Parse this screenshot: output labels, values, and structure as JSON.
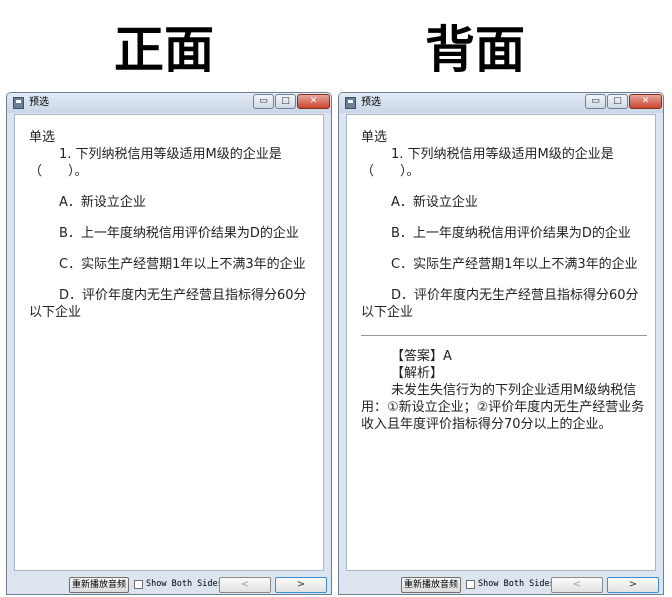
{
  "headings": {
    "front": "正面",
    "back": "背面"
  },
  "window": {
    "title": "预选",
    "minimize_glyph": "▭",
    "maximize_glyph": "□",
    "close_glyph": "✕"
  },
  "question": {
    "type": "单选",
    "stem": "1. 下列纳税信用等级适用M级的企业是（　　）。",
    "options": [
      "A．新设立企业",
      "B．上一年度纳税信用评价结果为D的企业",
      "C．实际生产经营期1年以上不满3年的企业",
      "D．评价年度内无生产经营且指标得分60分以下企业"
    ]
  },
  "answer": {
    "answer_label": "【答案】A",
    "explanation_label": "【解析】",
    "explanation": "未发生失信行为的下列企业适用M级纳税信用：①新设立企业；②评价年度内无生产经营业务收入且年度评价指标得分70分以上的企业。"
  },
  "bottom_bar": {
    "replay_label": "重新播放音频",
    "show_both_label": "Show Both Sides",
    "show_both_checked": false,
    "prev_glyph": "<",
    "next_glyph": ">"
  },
  "colors": {
    "next_focus": "#3a8fd6",
    "close_button": "#c9442d"
  }
}
